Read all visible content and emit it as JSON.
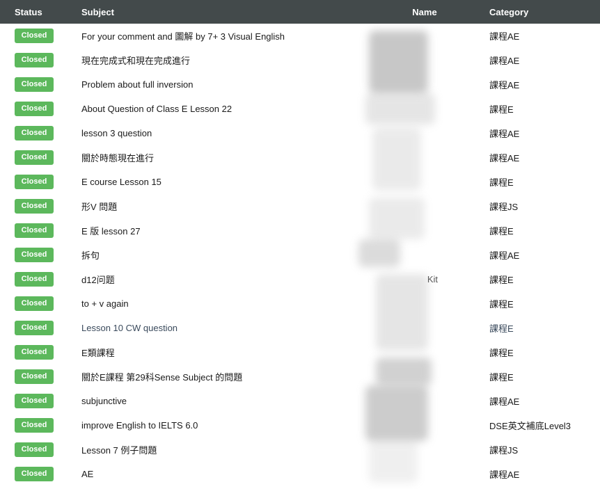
{
  "table": {
    "headers": {
      "status": "Status",
      "subject": "Subject",
      "name": "Name",
      "category": "Category"
    },
    "rows": [
      {
        "status": "Closed",
        "subject": "For your comment and 圖解 by 7+ 3 Visual English",
        "name": "",
        "category": "課程AE"
      },
      {
        "status": "Closed",
        "subject": "現在完成式和現在完成進行",
        "name": "",
        "category": "課程AE"
      },
      {
        "status": "Closed",
        "subject": "Problem about full inversion",
        "name": "",
        "category": "課程AE"
      },
      {
        "status": "Closed",
        "subject": "About Question of Class E Lesson 22",
        "name": "",
        "category": "課程E"
      },
      {
        "status": "Closed",
        "subject": "lesson 3 question",
        "name": "",
        "category": "課程AE"
      },
      {
        "status": "Closed",
        "subject": "關於時態現在進行",
        "name": "",
        "category": "課程AE"
      },
      {
        "status": "Closed",
        "subject": "E course Lesson 15",
        "name": "",
        "category": "課程E"
      },
      {
        "status": "Closed",
        "subject": "形V 問題",
        "name": "",
        "category": "課程JS"
      },
      {
        "status": "Closed",
        "subject": "E 版 lesson 27",
        "name": "",
        "category": "課程E"
      },
      {
        "status": "Closed",
        "subject": "拆句",
        "name": "",
        "category": "課程AE"
      },
      {
        "status": "Closed",
        "subject": "d12问题",
        "name": "Kit",
        "category": "課程E"
      },
      {
        "status": "Closed",
        "subject": "to + v again",
        "name": "",
        "category": "課程E"
      },
      {
        "status": "Closed",
        "subject": "Lesson 10 CW question",
        "name": "",
        "category": "課程E"
      },
      {
        "status": "Closed",
        "subject": "E類課程",
        "name": "",
        "category": "課程E"
      },
      {
        "status": "Closed",
        "subject": "關於E課程 第29科Sense Subject 的問題",
        "name": "",
        "category": "課程E"
      },
      {
        "status": "Closed",
        "subject": "subjunctive",
        "name": "",
        "category": "課程AE"
      },
      {
        "status": "Closed",
        "subject": "improve English to IELTS 6.0",
        "name": "",
        "category": "DSE英文補底Level3"
      },
      {
        "status": "Closed",
        "subject": "Lesson 7 例子問題",
        "name": "",
        "category": "課程JS"
      },
      {
        "status": "Closed",
        "subject": "AE",
        "name": "",
        "category": "課程AE"
      }
    ],
    "hovered_row_index": 12
  },
  "colors": {
    "header_bg": "#434a4b",
    "badge_closed": "#5cb85c",
    "hover_text": "#3a4a5c"
  }
}
